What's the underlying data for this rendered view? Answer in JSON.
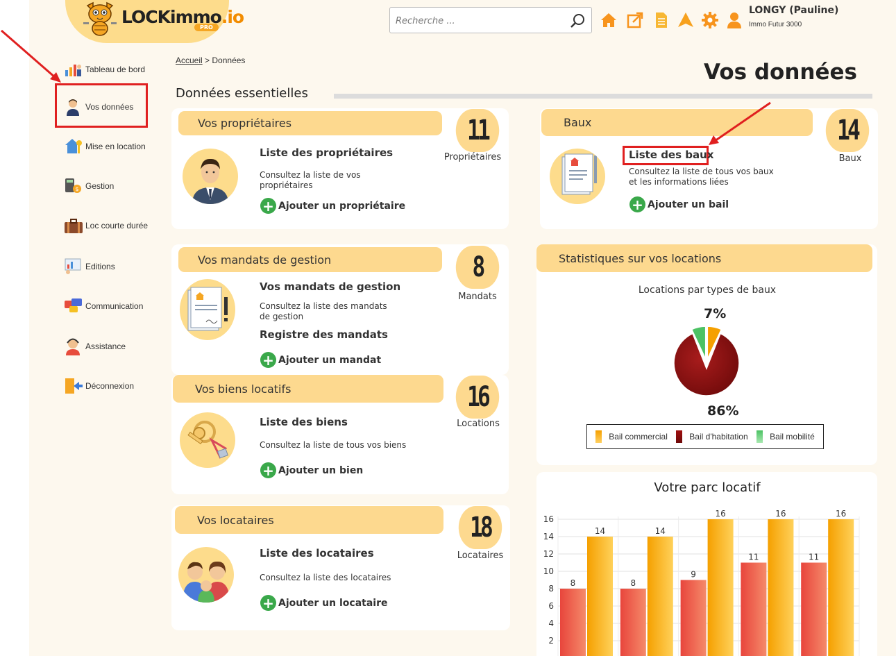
{
  "header": {
    "logo_text": "LOCKimmo",
    "logo_suffix": ".io",
    "logo_badge": "PRO",
    "search_placeholder": "Recherche ...",
    "user_name": "LONGY (Pauline)",
    "user_agency": "Immo Futur 3000",
    "icons": [
      "home-icon",
      "external-link-icon",
      "document-icon",
      "navigation-icon",
      "gear-icon",
      "user-icon"
    ]
  },
  "sidebar": {
    "items": [
      {
        "label": "Tableau de bord",
        "icon": "dashboard-icon"
      },
      {
        "label": "Vos données",
        "icon": "person-icon"
      },
      {
        "label": "Mise en location",
        "icon": "house-key-icon"
      },
      {
        "label": "Gestion",
        "icon": "calculator-icon"
      },
      {
        "label": "Loc courte durée",
        "icon": "suitcase-icon"
      },
      {
        "label": "Editions",
        "icon": "presentation-icon"
      },
      {
        "label": "Communication",
        "icon": "chat-bubbles-icon"
      },
      {
        "label": "Assistance",
        "icon": "headset-icon"
      },
      {
        "label": "Déconnexion",
        "icon": "logout-icon"
      }
    ]
  },
  "breadcrumb": {
    "home": "Accueil",
    "separator": ">",
    "current": "Données"
  },
  "page_title": "Vos données",
  "section_title": "Données essentielles",
  "cards": {
    "proprietaires": {
      "title": "Vos propriétaires",
      "count": "11",
      "count_label": "Propriétaires",
      "link": "Liste des propriétaires",
      "desc_1": "Consultez la liste de vos",
      "desc_2": "propriétaires",
      "add": "Ajouter un propriétaire"
    },
    "baux": {
      "title": "Baux",
      "count": "14",
      "count_label": "Baux",
      "link": "Liste des baux",
      "desc_1": "Consultez la liste de tous vos baux",
      "desc_2": "et les informations liées",
      "add": "Ajouter un bail"
    },
    "mandats": {
      "title": "Vos mandats de gestion",
      "count": "8",
      "count_label": "Mandats",
      "link": "Vos mandats de gestion",
      "desc_1": "Consultez la liste des mandats",
      "desc_2": "de gestion",
      "link_2": "Registre des mandats",
      "add": "Ajouter un mandat"
    },
    "biens": {
      "title": "Vos biens locatifs",
      "count": "16",
      "count_label": "Locations",
      "link": "Liste des biens",
      "desc_1": "Consultez la liste de tous vos biens",
      "add": "Ajouter un bien"
    },
    "locataires": {
      "title": "Vos locataires",
      "count": "18",
      "count_label": "Locataires",
      "link": "Liste des locataires",
      "desc_1": "Consultez la liste des locataires",
      "add": "Ajouter un locataire"
    },
    "stats": {
      "title": "Statistiques sur vos locations"
    }
  },
  "chart_data": [
    {
      "type": "pie",
      "title": "Locations par types de baux",
      "labels": [
        "Bail commercial",
        "Bail d'habitation",
        "Bail mobilité"
      ],
      "values": [
        7,
        86,
        7
      ],
      "slice_labels": [
        "7%",
        "86%"
      ],
      "colors": [
        "#f5a000",
        "#8b0f0f",
        "#4cc264"
      ],
      "legend": "bottom"
    },
    {
      "type": "bar",
      "title": "Votre parc locatif",
      "categories": [
        "",
        "",
        "",
        "",
        ""
      ],
      "series": [
        {
          "values": [
            8,
            8,
            9,
            11,
            11
          ],
          "color": "#e8453c"
        },
        {
          "values": [
            14,
            14,
            16,
            16,
            16
          ],
          "color": "#fbb624"
        }
      ],
      "ylim": [
        0,
        16
      ],
      "yticks": [
        "2",
        "4",
        "6",
        "8",
        "10",
        "12",
        "14",
        "16"
      ],
      "grid": true
    }
  ]
}
